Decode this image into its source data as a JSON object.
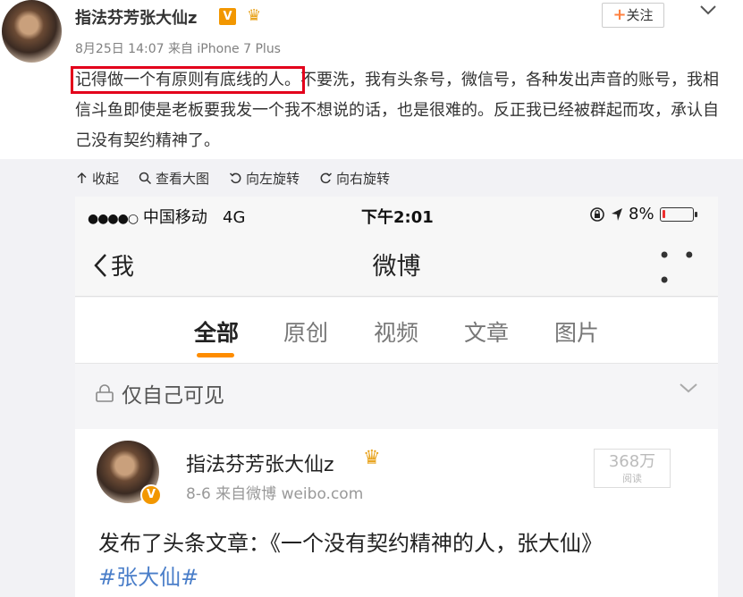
{
  "post": {
    "username": "指法芬芳张大仙z",
    "verified_badge": "V",
    "meta": "8月25日 14:07 来自 iPhone 7 Plus",
    "follow_label": "关注",
    "text_highlighted": "记得做一个有原则有底线的人。",
    "text_rest": "不要洗，我有头条号，微信号，各种发出声音的账号，我相信斗鱼即使是老板要我发一个我不想说的话，也是很难的。反正我已经被群起而攻，承认自己没有契约精神了。",
    "highlight_color": "#e3001b"
  },
  "image_toolbar": {
    "collapse": "收起",
    "view_large": "查看大图",
    "rotate_left": "向左旋转",
    "rotate_right": "向右旋转"
  },
  "phone": {
    "status_bar": {
      "signal": "●●●●○",
      "carrier": "中国移动",
      "network": "4G",
      "time": "下午2:01",
      "battery": "8%",
      "battery_level": 0.08
    },
    "nav": {
      "back_label": "我",
      "title": "微博",
      "more": "• • •"
    },
    "tabs": [
      "全部",
      "原创",
      "视频",
      "文章",
      "图片"
    ],
    "active_tab": "全部",
    "accent_color": "#fe8c00",
    "privacy": "仅自己可见",
    "card": {
      "name": "指法芬芳张大仙z",
      "meta": "8-6  来自微博 weibo.com",
      "reads_count": "368万",
      "reads_label": "阅读",
      "text": "发布了头条文章：《一个没有契约精神的人，张大仙》",
      "hashtag": "#张大仙#"
    }
  }
}
